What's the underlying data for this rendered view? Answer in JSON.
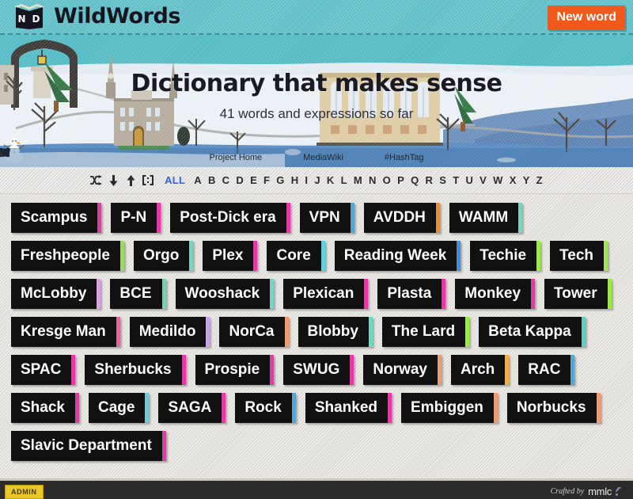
{
  "header": {
    "logo_letters": "ND",
    "brand_title": "WildWords",
    "new_word_label": "New word"
  },
  "banner": {
    "title": "Dictionary that makes sense",
    "subtitle": "41 words and expressions so far",
    "nav": [
      {
        "label": "Project Home",
        "icon": "home-icon"
      },
      {
        "label": "MediaWiki",
        "icon": "brackets-icon"
      },
      {
        "label": "#HashTag",
        "icon": "twitter-bird-icon"
      }
    ]
  },
  "filterbar": {
    "icons": [
      {
        "name": "shuffle-icon"
      },
      {
        "name": "sort-descending-icon"
      },
      {
        "name": "sort-ascending-icon"
      },
      {
        "name": "brackets-icon"
      }
    ],
    "all_label": "ALL",
    "active_filter": "ALL",
    "letters": [
      "A",
      "B",
      "C",
      "D",
      "E",
      "F",
      "G",
      "H",
      "I",
      "J",
      "K",
      "L",
      "M",
      "N",
      "O",
      "P",
      "Q",
      "R",
      "S",
      "T",
      "U",
      "V",
      "W",
      "X",
      "Y",
      "Z"
    ]
  },
  "words": [
    {
      "label": "Scampus",
      "accent": "#e838a6"
    },
    {
      "label": "P-N",
      "accent": "#e838a6"
    },
    {
      "label": "Post-Dick era",
      "accent": "#e838a6"
    },
    {
      "label": "VPN",
      "accent": "#4aa8e0"
    },
    {
      "label": "AVDDH",
      "accent": "#f28b28"
    },
    {
      "label": "WAMM",
      "accent": "#6fd8c2"
    },
    {
      "label": "Freshpeople",
      "accent": "#9fd66a"
    },
    {
      "label": "Orgo",
      "accent": "#6fd8c2"
    },
    {
      "label": "Plex",
      "accent": "#e838a6"
    },
    {
      "label": "Core",
      "accent": "#5fd2dd"
    },
    {
      "label": "Reading Week",
      "accent": "#3f8fe0"
    },
    {
      "label": "Techie",
      "accent": "#9fe84a"
    },
    {
      "label": "Tech",
      "accent": "#9fe84a"
    },
    {
      "label": "McLobby",
      "accent": "#d9a3e0"
    },
    {
      "label": "BCE",
      "accent": "#6fd8a8"
    },
    {
      "label": "Wooshack",
      "accent": "#6fd8c2"
    },
    {
      "label": "Plexican",
      "accent": "#e838a6"
    },
    {
      "label": "Plasta",
      "accent": "#e838a6"
    },
    {
      "label": "Monkey",
      "accent": "#e838a6"
    },
    {
      "label": "Tower",
      "accent": "#9fe84a"
    },
    {
      "label": "Kresge Man",
      "accent": "#ef5f9e"
    },
    {
      "label": "Medildo",
      "accent": "#c9a8e8"
    },
    {
      "label": "NorCa",
      "accent": "#f09a72"
    },
    {
      "label": "Blobby",
      "accent": "#6fd8c2"
    },
    {
      "label": "The Lard",
      "accent": "#9fe84a"
    },
    {
      "label": "Beta Kappa",
      "accent": "#4fd6c8"
    },
    {
      "label": "SPAC",
      "accent": "#e838a6"
    },
    {
      "label": "Sherbucks",
      "accent": "#e838a6"
    },
    {
      "label": "Prospie",
      "accent": "#e838a6"
    },
    {
      "label": "SWUG",
      "accent": "#e838a6"
    },
    {
      "label": "Norway",
      "accent": "#f09a72"
    },
    {
      "label": "Arch",
      "accent": "#efae4a"
    },
    {
      "label": "RAC",
      "accent": "#4aa8e0"
    },
    {
      "label": "Shack",
      "accent": "#e838a6"
    },
    {
      "label": "Cage",
      "accent": "#5fd2dd"
    },
    {
      "label": "SAGA",
      "accent": "#e838a6"
    },
    {
      "label": "Rock",
      "accent": "#4aa8e0"
    },
    {
      "label": "Shanked",
      "accent": "#e838a6"
    },
    {
      "label": "Embiggen",
      "accent": "#f09a72"
    },
    {
      "label": "Norbucks",
      "accent": "#f09a72"
    },
    {
      "label": "Slavic Department",
      "accent": "#e838a6"
    }
  ],
  "footer": {
    "admin_label": "ADMIN",
    "crafted_label": "Crafted by",
    "crafted_brand": "mmlc"
  },
  "colors": {
    "header_bg": "#64c4cd",
    "accent_button": "#f1581c",
    "tag_bg": "#111111",
    "active_filter": "#2f62f0",
    "footer_bg": "#2b2b2b",
    "admin_badge": "#e9c72b"
  }
}
